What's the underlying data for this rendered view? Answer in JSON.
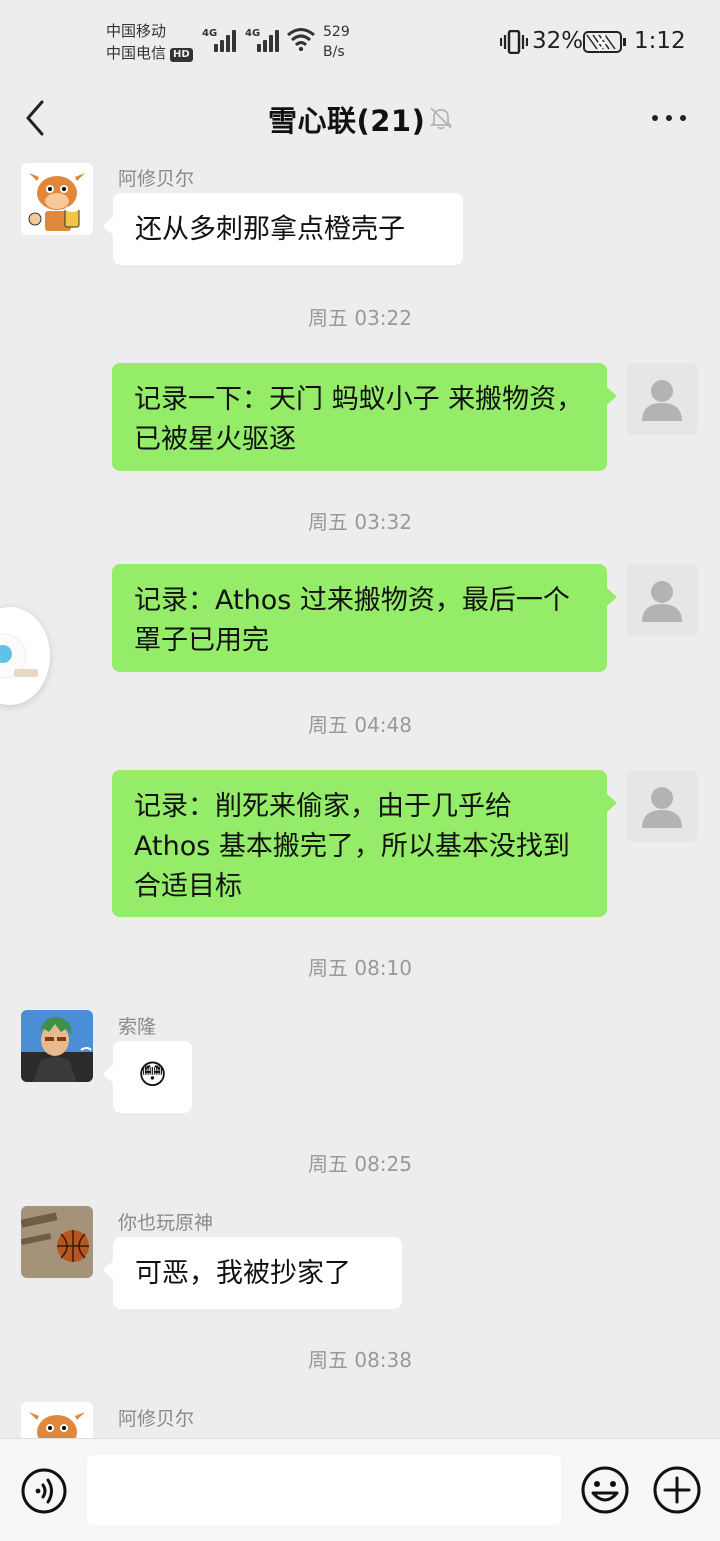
{
  "status_bar": {
    "carrier_1": "中国移动",
    "carrier_2": "中国电信",
    "hd_label": "HD",
    "network_1": "4G",
    "network_2": "4G",
    "speed_value": "529",
    "speed_unit": "B/s",
    "battery_percent": "32%",
    "time": "1:12"
  },
  "header": {
    "title": "雪心联(21)",
    "muted": true
  },
  "messages": [
    {
      "kind": "in",
      "sender": "阿修贝尔",
      "text": "还从多刺那拿点橙壳子",
      "avatar": "cow-cartoon-avatar"
    },
    {
      "kind": "time",
      "text": "周五 03:22"
    },
    {
      "kind": "out",
      "text": "记录一下：天门 蚂蚁小子 来搬物资，已被星火驱逐"
    },
    {
      "kind": "time",
      "text": "周五 03:32"
    },
    {
      "kind": "out",
      "text": "记录：Athos 过来搬物资，最后一个罩子已用完"
    },
    {
      "kind": "time",
      "text": "周五 04:48"
    },
    {
      "kind": "out",
      "text": "记录：削死来偷家，由于几乎给Athos 基本搬完了，所以基本没找到合适目标"
    },
    {
      "kind": "time",
      "text": "周五 08:10"
    },
    {
      "kind": "in",
      "sender": "索隆",
      "text": "😳",
      "avatar": "anime-character-avatar"
    },
    {
      "kind": "time",
      "text": "周五 08:25"
    },
    {
      "kind": "in",
      "sender": "你也玩原神",
      "text": "可恶，我被抄家了",
      "avatar": "basketball-avatar"
    },
    {
      "kind": "time",
      "text": "周五 08:38"
    },
    {
      "kind": "in",
      "sender": "阿修贝尔",
      "text": "",
      "avatar": "cow-cartoon-avatar"
    }
  ],
  "input_bar": {
    "placeholder": ""
  },
  "colors": {
    "background": "#ededed",
    "outgoing_bubble": "#95ec69",
    "incoming_bubble": "#ffffff",
    "timestamp_text": "#999999"
  }
}
